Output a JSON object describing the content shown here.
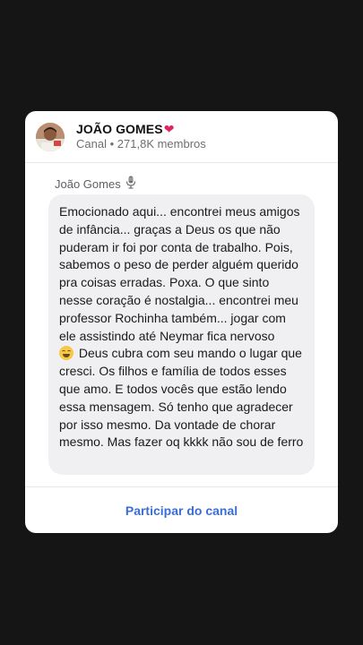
{
  "channel": {
    "name": "JOÃO GOMES",
    "name_icon": "red-heart-icon",
    "type_label": "Canal",
    "separator": "•",
    "members": "271,8K membros"
  },
  "post": {
    "author": "João Gomes",
    "author_icon": "microphone-icon",
    "message_part1": "Emocionado aqui... encontrei meus amigos de infância... graças a Deus os que não puderam ir foi por conta de trabalho. Pois, sabemos o peso de perder alguém querido pra coisas erradas. Poxa. O que sinto nesse coração é nostalgia... encontrei meu professor Rochinha também... jogar com ele assistindo até Neymar fica nervoso",
    "message_emoji": "grinning-sweat-emoji",
    "message_part2": " Deus cubra com seu mando o lugar que cresci. Os filhos e família de todos esses que amo. E todos vocês que estão lendo essa mensagem. Só tenho que agradecer por isso mesmo. Da vontade de chorar mesmo. Mas fazer oq kkkk não sou de ferro"
  },
  "footer": {
    "join_label": "Participar do canal"
  },
  "colors": {
    "background": "#151515",
    "card": "#ffffff",
    "bubble": "#f0f0f2",
    "link": "#3a6ed6",
    "heart": "#e0245e"
  }
}
